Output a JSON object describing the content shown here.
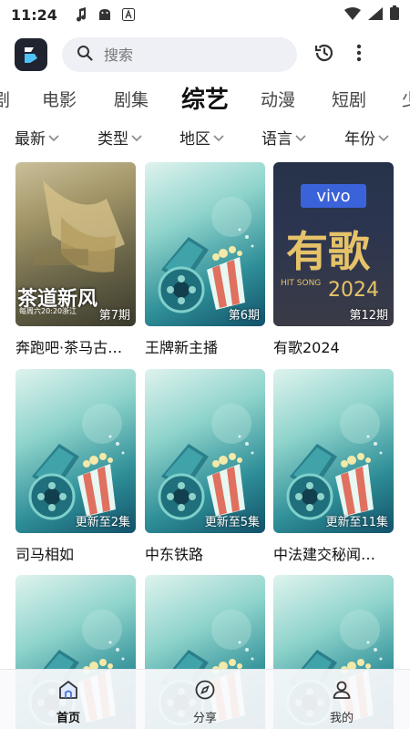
{
  "status_bar": {
    "time": "11:24"
  },
  "search": {
    "placeholder": "搜索"
  },
  "categories": [
    "剧",
    "电影",
    "剧集",
    "综艺",
    "动漫",
    "短剧",
    "少"
  ],
  "active_category": "综艺",
  "filters": [
    "最新",
    "类型",
    "地区",
    "语言",
    "年份"
  ],
  "cards": [
    {
      "title": "奔跑吧·茶马古…",
      "badge": "第7期",
      "poster": "show-poster"
    },
    {
      "title": "王牌新主播",
      "badge": "第6期",
      "poster": "placeholder-film-reel"
    },
    {
      "title": "有歌2024",
      "badge": "第12期",
      "poster": "show-poster"
    },
    {
      "title": "司马相如",
      "badge": "更新至2集",
      "poster": "placeholder-film-reel"
    },
    {
      "title": "中东铁路",
      "badge": "更新至5集",
      "poster": "placeholder-film-reel"
    },
    {
      "title": "中法建交秘闻…",
      "badge": "更新至11集",
      "poster": "placeholder-film-reel"
    },
    {
      "title": "",
      "badge": "",
      "poster": "placeholder-film-reel"
    },
    {
      "title": "",
      "badge": "",
      "poster": "placeholder-film-reel"
    },
    {
      "title": "",
      "badge": "",
      "poster": "placeholder-film-reel"
    }
  ],
  "poster1_text": {
    "caption": "茶道新风",
    "sub": "每周六20:20浙江"
  },
  "poster3_text": {
    "brand": "vivo",
    "title": "有歌",
    "year": "2024",
    "sub": "HIT SONG"
  },
  "bottom_nav": [
    {
      "label": "首页",
      "icon": "home-icon"
    },
    {
      "label": "分享",
      "icon": "compass-icon"
    },
    {
      "label": "我的",
      "icon": "user-icon"
    }
  ],
  "colors": {
    "accent": "#1f2430",
    "search_bg": "#eef0f5"
  }
}
